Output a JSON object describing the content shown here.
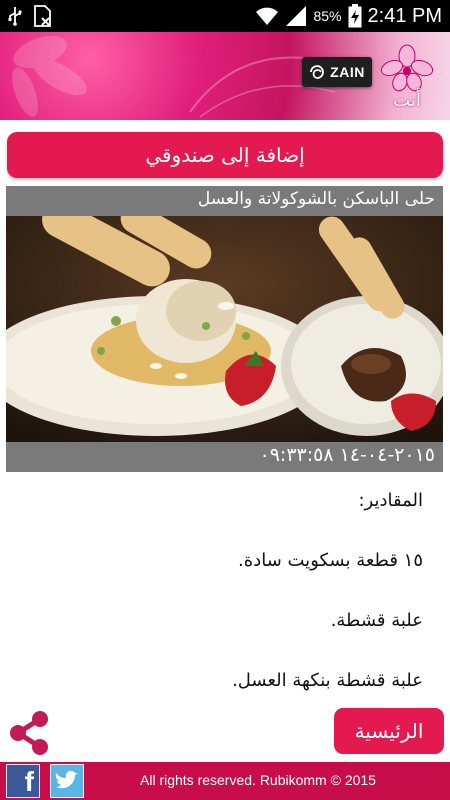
{
  "status_bar": {
    "battery_percent": "85%",
    "time": "2:41 PM",
    "icons": [
      "usb-icon",
      "no-sim-icon",
      "wifi-icon",
      "signal-icon",
      "battery-charging-icon"
    ]
  },
  "header": {
    "partner_logo_text": "ZAIN",
    "app_logo_text": "أنت"
  },
  "add_button_label": "إضافة إلى صندوقي",
  "article": {
    "title": "حلى الباسكن بالشوكولاتة والعسل",
    "datetime": "٢٠١٥-٠٤-١٤ ٠٩:٣٣:٥٨",
    "lines": [
      "المقادير:",
      "١٥ قطعة بسكويت سادة.",
      "علبة قشطة.",
      "علبة قشطة بنكهة العسل."
    ]
  },
  "home_button_label": "الرئيسية",
  "footer": {
    "copyright": "All rights reserved. Rubikomm © 2015",
    "facebook_glyph": "f"
  },
  "colors": {
    "accent": "#e3194f",
    "footer": "#c70d4a",
    "caption_bar": "#7a7a7a",
    "share_icon": "#c41a55"
  }
}
